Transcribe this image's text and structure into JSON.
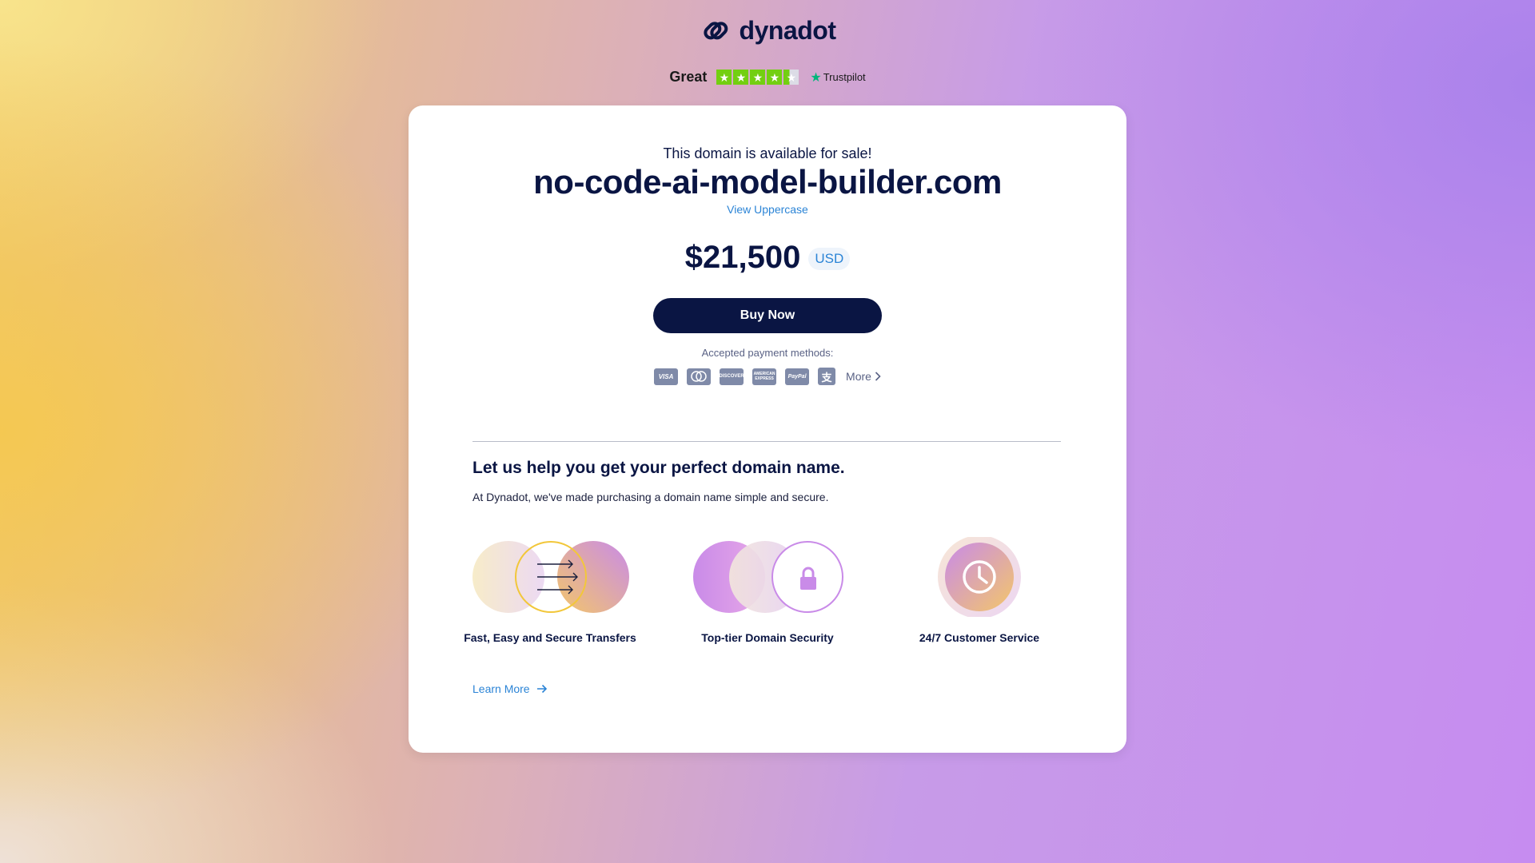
{
  "brand": {
    "name": "dynadot",
    "icon": "chain-link-icon"
  },
  "trustpilot": {
    "rating_label": "Great",
    "stars": 4.5,
    "brand": "Trustpilot",
    "accent": "#73cf11"
  },
  "listing": {
    "sale_label": "This domain is available for sale!",
    "domain": "no-code-ai-model-builder.com",
    "view_uppercase": "View Uppercase",
    "price": "$21,500",
    "currency": "USD",
    "buy_label": "Buy Now"
  },
  "payment": {
    "label": "Accepted payment methods:",
    "methods": [
      "VISA",
      "Mastercard",
      "Discover",
      "American Express",
      "PayPal",
      "Alipay"
    ],
    "more": "More"
  },
  "help": {
    "title": "Let us help you get your perfect domain name.",
    "subtitle": "At Dynadot, we've made purchasing a domain name simple and secure.",
    "features": [
      {
        "title": "Fast, Easy and Secure Transfers",
        "icon": "transfer-arrows-icon"
      },
      {
        "title": "Top-tier Domain Security",
        "icon": "lock-icon"
      },
      {
        "title": "24/7 Customer Service",
        "icon": "clock-icon"
      }
    ],
    "learn_more": "Learn More"
  },
  "colors": {
    "navy": "#0a1543",
    "link": "#2b84d6",
    "card": "#ffffff"
  }
}
